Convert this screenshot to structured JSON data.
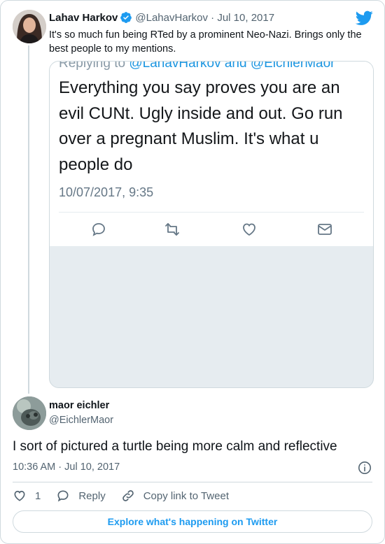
{
  "colors": {
    "accent": "#1d9bf0",
    "text_primary": "#0f1419",
    "text_secondary": "#536471",
    "border": "#cfd9de"
  },
  "tweet": {
    "author_name": "Lahav Harkov",
    "author_handle": "@LahavHarkov",
    "date": "Jul 10, 2017",
    "handle_and_date": "@LahavHarkov · Jul 10, 2017",
    "text": "It's so much fun being RTed by a prominent Neo-Nazi. Brings only the best people to my mentions.",
    "verified_icon": "verified-badge-icon",
    "brand_icon": "twitter-bird-icon"
  },
  "embedded_screenshot": {
    "reply_prefix": "Replying to",
    "reply_mentions": "@LahavHarkov and @EichlerMaor",
    "text": "Everything you say proves you are an evil CUNt. Ugly inside and out. Go run over a pregnant Muslim. It's what u people do",
    "timestamp": "10/07/2017, 9:35",
    "action_icons": [
      "reply-icon",
      "retweet-icon",
      "like-icon",
      "direct-message-icon"
    ]
  },
  "quoted": {
    "author_name": "maor eichler",
    "author_handle": "@EichlerMaor",
    "text": "I sort of pictured a turtle being more calm and reflective",
    "meta": "10:36 AM · Jul 10, 2017",
    "info_icon": "info-icon"
  },
  "actions": {
    "like_count": "1",
    "reply_label": "Reply",
    "copy_link_label": "Copy link to Tweet"
  },
  "explore_label": "Explore what's happening on Twitter"
}
